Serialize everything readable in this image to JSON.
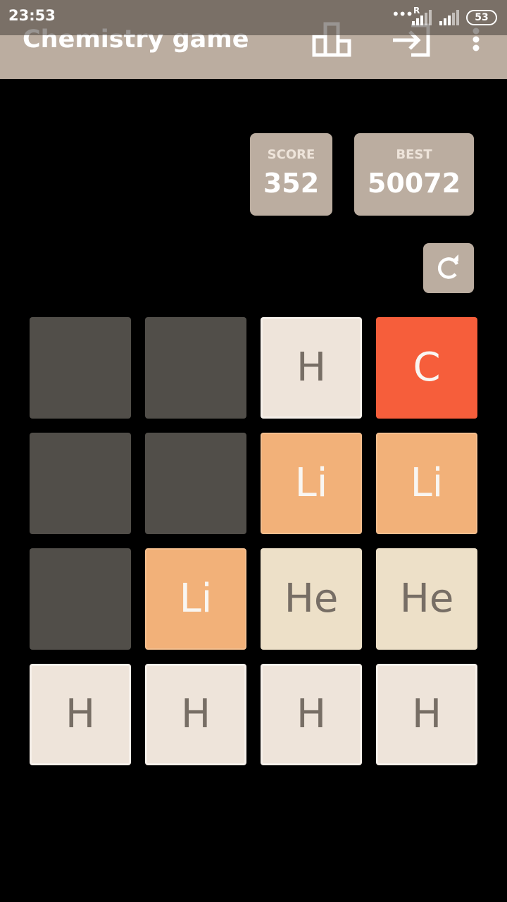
{
  "status_bar": {
    "time": "23:53",
    "dots": "•••",
    "network_label": "R",
    "battery": "53"
  },
  "action_bar": {
    "title": "Chemistry game",
    "icons": [
      "leaderboard-icon",
      "sign-in-icon",
      "overflow-menu-icon"
    ]
  },
  "score": {
    "label": "SCORE",
    "value": "352"
  },
  "best": {
    "label": "BEST",
    "value": "50072"
  },
  "restart": {
    "icon": "refresh-icon"
  },
  "colors": {
    "action_bar": "#bbada0",
    "empty_cell": "#514e49",
    "tile_h": "#eee4da",
    "tile_he": "#ede0c8",
    "tile_li": "#f2b179",
    "tile_c": "#f65e3b"
  },
  "board": {
    "rows": [
      [
        "",
        "",
        "H",
        "C"
      ],
      [
        "",
        "",
        "Li",
        "Li"
      ],
      [
        "",
        "Li",
        "He",
        "He"
      ],
      [
        "H",
        "H",
        "H",
        "H"
      ]
    ]
  }
}
